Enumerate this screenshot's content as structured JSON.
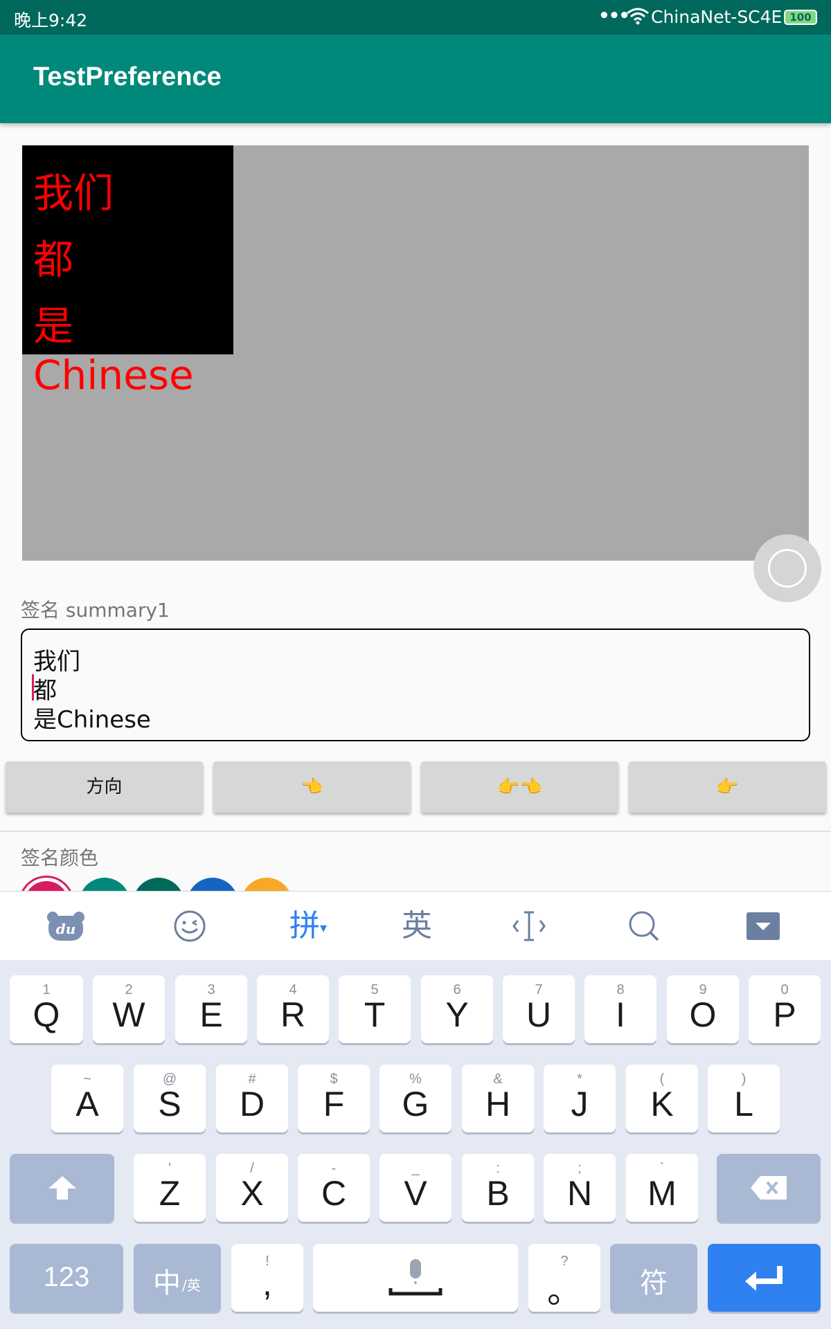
{
  "status_bar": {
    "time": "晚上9:42",
    "more": "•••",
    "wifi_icon": "wifi-icon",
    "ssid": "ChinaNet-SC4E",
    "battery": "100"
  },
  "toolbar": {
    "title": "TestPreference"
  },
  "canvas": {
    "signature_lines": [
      "我们",
      "都",
      "是Chinese"
    ],
    "background_color": "#a9a9a9",
    "signature_background": "#000000",
    "signature_color": "#ff0000"
  },
  "signature_section": {
    "summary": "签名  summary1",
    "text_lines": [
      "我们",
      "都",
      "是Chinese"
    ]
  },
  "buttons": {
    "direction": "方向",
    "left_hand": "👈",
    "both_hands": "👉👈",
    "right_hand": "👉"
  },
  "color_section": {
    "label": "签名颜色",
    "swatches": [
      "#d81b60",
      "#00897b",
      "#00695c",
      "#1565c0",
      "#f9a825"
    ]
  },
  "keyboard": {
    "toolbar": {
      "logo": "du",
      "emoji_icon": "emoji-icon",
      "pinyin": "拼",
      "english": "英",
      "cursor_icon": "cursor-icon",
      "search_icon": "search-icon",
      "hide_icon": "hide-keyboard-icon"
    },
    "row1": [
      {
        "main": "Q",
        "hint": "1"
      },
      {
        "main": "W",
        "hint": "2"
      },
      {
        "main": "E",
        "hint": "3"
      },
      {
        "main": "R",
        "hint": "4"
      },
      {
        "main": "T",
        "hint": "5"
      },
      {
        "main": "Y",
        "hint": "6"
      },
      {
        "main": "U",
        "hint": "7"
      },
      {
        "main": "I",
        "hint": "8"
      },
      {
        "main": "O",
        "hint": "9"
      },
      {
        "main": "P",
        "hint": "0"
      }
    ],
    "row2": [
      {
        "main": "A",
        "hint": "~"
      },
      {
        "main": "S",
        "hint": "@"
      },
      {
        "main": "D",
        "hint": "#"
      },
      {
        "main": "F",
        "hint": "$"
      },
      {
        "main": "G",
        "hint": "%"
      },
      {
        "main": "H",
        "hint": "&"
      },
      {
        "main": "J",
        "hint": "*"
      },
      {
        "main": "K",
        "hint": "("
      },
      {
        "main": "L",
        "hint": ")"
      }
    ],
    "row3": [
      {
        "main": "Z",
        "hint": "'"
      },
      {
        "main": "X",
        "hint": "/"
      },
      {
        "main": "C",
        "hint": "-"
      },
      {
        "main": "V",
        "hint": "_"
      },
      {
        "main": "B",
        "hint": ":"
      },
      {
        "main": "N",
        "hint": ";"
      },
      {
        "main": "M",
        "hint": "`"
      }
    ],
    "shift_icon": "shift-icon",
    "backspace_icon": "backspace-icon",
    "numbers": "123",
    "lang_main": "中",
    "lang_sub": "/英",
    "comma_hint": "!",
    "comma": ",",
    "mic_icon": "mic-icon",
    "period_hint": "?",
    "period": "。",
    "symbols": "符",
    "enter_icon": "enter-icon"
  }
}
